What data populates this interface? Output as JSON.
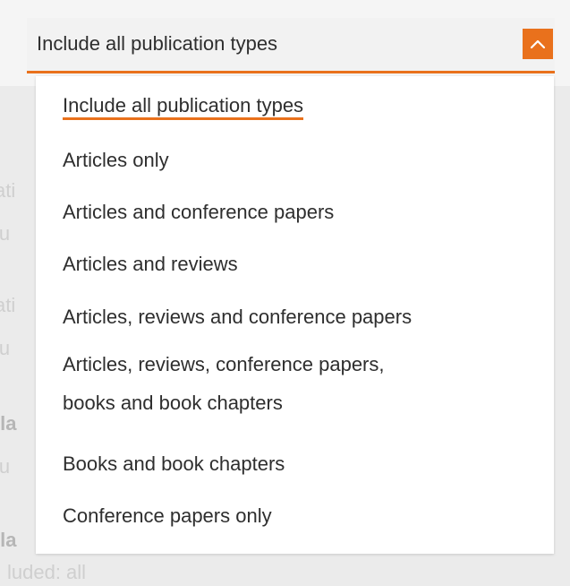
{
  "select": {
    "value": "Include all publication types",
    "toggle_icon": "chevron-up-icon",
    "accent_color": "#e9711c"
  },
  "options": [
    {
      "label": "Include all publication types",
      "selected": true
    },
    {
      "label": "Articles only",
      "selected": false
    },
    {
      "label": "Articles and conference papers",
      "selected": false
    },
    {
      "label": "Articles and reviews",
      "selected": false
    },
    {
      "label": "Articles, reviews and conference papers",
      "selected": false
    },
    {
      "label_line1": "Articles, reviews, conference papers,",
      "label_line2": "books and book chapters",
      "selected": false
    },
    {
      "label": "Books and book chapters",
      "selected": false
    },
    {
      "label": "Conference papers only",
      "selected": false
    }
  ],
  "background": {
    "rows": [
      {
        "text": "ati",
        "style": "label"
      },
      {
        "text": "lu",
        "style": "sub"
      },
      {
        "text": "ati",
        "style": "label"
      },
      {
        "text": "lu",
        "style": "sub"
      },
      {
        "text": "lla",
        "style": "strong"
      },
      {
        "text": "lu",
        "style": "sub"
      },
      {
        "text": "lla",
        "style": "strong"
      },
      {
        "text": "luded: all",
        "style": "sub"
      }
    ]
  }
}
